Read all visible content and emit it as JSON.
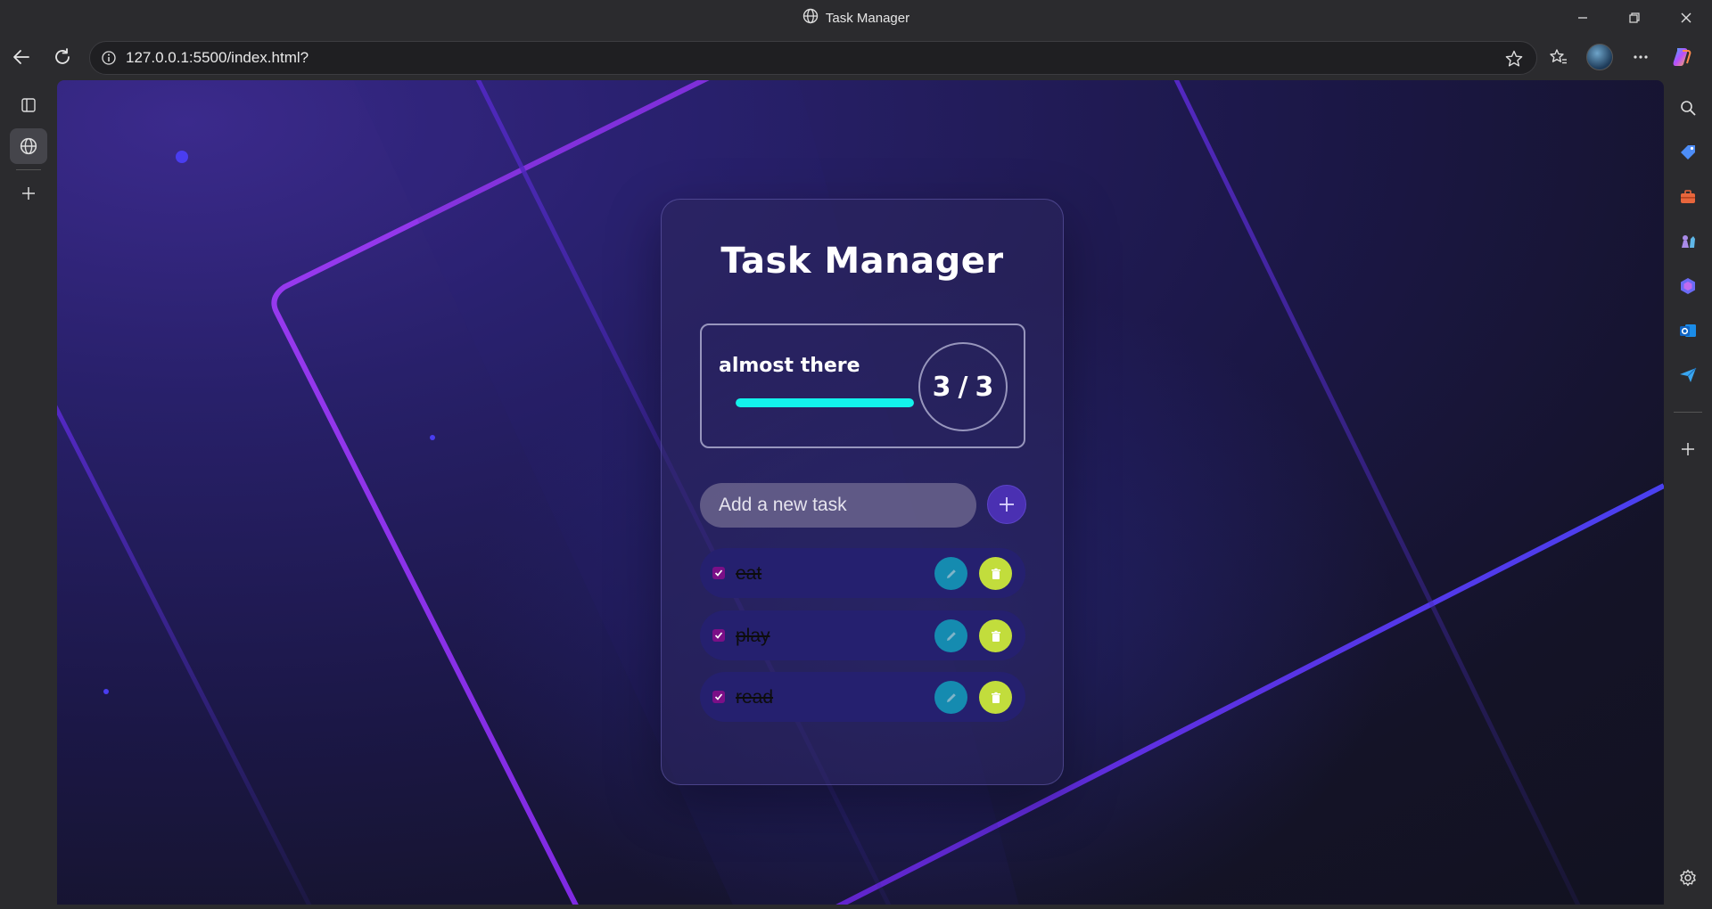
{
  "window": {
    "title": "Task Manager"
  },
  "browser": {
    "url": "127.0.0.1:5500/index.html?"
  },
  "app": {
    "title": "Task Manager",
    "stats": {
      "label": "almost there",
      "completed": "3",
      "separator": "/",
      "total": "3",
      "progress_fraction": 1.0
    },
    "input": {
      "placeholder": "Add a new task",
      "value": ""
    },
    "tasks": [
      {
        "text": "eat",
        "completed": true
      },
      {
        "text": "play",
        "completed": true
      },
      {
        "text": "read",
        "completed": true
      }
    ]
  },
  "colors": {
    "progress": "#13f2ec",
    "add_button": "#4a30b2",
    "task_bg": "#25206f",
    "checkbox": "#7b0f87",
    "edit_button": "#158bb0",
    "delete_button": "#c2dd3c",
    "accent_line": "#8a2be2"
  },
  "icons": {
    "window_title": "globe-icon",
    "add": "plus-icon",
    "edit": "pencil-icon",
    "delete": "trash-icon"
  }
}
